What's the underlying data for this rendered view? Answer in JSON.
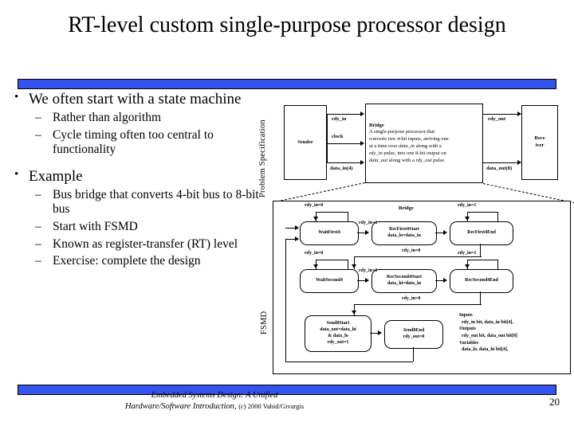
{
  "slide": {
    "title": "RT-level custom single-purpose processor design",
    "page_number": "20",
    "accent_color": "#3355ee",
    "footer_line1": "Embedded Systems Design: A Unified",
    "footer_line2": "Hardware/Software Introduction,",
    "footer_credit": "(c) 2000 Vahid/Givargis"
  },
  "bullets": {
    "bullet_marker": "•",
    "dash_marker": "–",
    "items": [
      {
        "text": "We often start with a state machine",
        "subs": [
          "Rather than algorithm",
          "Cycle timing often too central to functionality"
        ]
      },
      {
        "text": "Example",
        "subs": [
          "Bus bridge that converts 4-bit bus to 8-bit bus",
          "Start with FSMD",
          "Known as register-transfer (RT) level",
          "Exercise: complete the design"
        ]
      }
    ]
  },
  "problem_spec": {
    "panel_label": "Problem Specification",
    "sender": "Sender",
    "receiver_line1": "Rece",
    "receiver_line2": "iver",
    "bridge_title": "Bridge",
    "bridge_desc_1": "A single-purpose processor that",
    "bridge_desc_2": "converts two 4-bit inputs, arriving one",
    "bridge_desc_3a": "at a time over ",
    "bridge_desc_3b": "data_in",
    "bridge_desc_3c": " along with a",
    "bridge_desc_4a": "rdy_in",
    "bridge_desc_4b": " pulse, into one 8-bit output on",
    "bridge_desc_5a": "data_out",
    "bridge_desc_5b": " along with a ",
    "bridge_desc_5c": "rdy_out",
    "bridge_desc_5d": " pulse.",
    "signal_rdy_in": "rdy_in",
    "signal_clock": "clock",
    "signal_data_in": "data_in(4)",
    "signal_rdy_out": "rdy_out",
    "signal_data_out": "data_out(8)"
  },
  "fsmd": {
    "panel_label": "FSMD",
    "title": "Bridge",
    "states": [
      {
        "name": "WaitFirst4",
        "l2": "",
        "l3": "",
        "l4": ""
      },
      {
        "name": "RecFirst4Start",
        "l2": "data_lo=data_in",
        "l3": "",
        "l4": ""
      },
      {
        "name": "RecFirst4End",
        "l2": "",
        "l3": "",
        "l4": ""
      },
      {
        "name": "WaitSecond4",
        "l2": "",
        "l3": "",
        "l4": ""
      },
      {
        "name": "RecSecond4Start",
        "l2": "data_hi=data_in",
        "l3": "",
        "l4": ""
      },
      {
        "name": "RecSecond4End",
        "l2": "",
        "l3": "",
        "l4": ""
      },
      {
        "name": "Send8Start",
        "l2": "data_out=data_hi",
        "l3": "& data_lo",
        "l4": "rdy_out=1"
      },
      {
        "name": "Send8End",
        "l2": "rdy_out=0",
        "l3": "",
        "l4": ""
      }
    ],
    "transitions": {
      "wait1_self": "rdy_in=0",
      "wait1_out": "rdy_in=1",
      "end1_self": "rdy_in=1",
      "end1_out": "rdy_in=0",
      "wait2_self": "rdy_in=0",
      "wait2_out": "rdy_in=1",
      "end2_self": "rdy_in=1",
      "end2_out": "rdy_in=0"
    },
    "legend": {
      "inputs_head": "Inputs",
      "inputs_body": "rdy_in bit, data_in bit[4],",
      "outputs_head": "Outputs",
      "outputs_body": "rdy_out bit, data_out bit[8]",
      "variables_head": "Variables",
      "variables_body": "data_lo, data_hi bit[4],"
    }
  }
}
